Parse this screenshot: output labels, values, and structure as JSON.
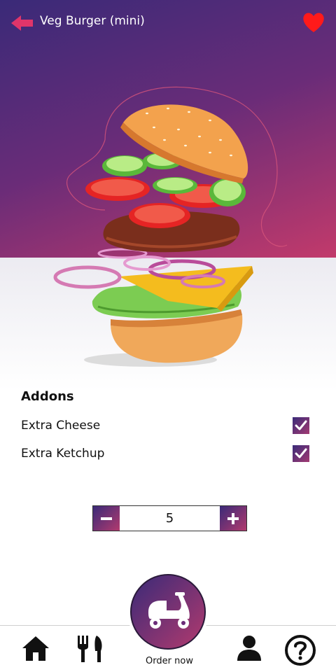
{
  "header": {
    "title": "Veg Burger (mini)",
    "back_icon": "arrow-left-icon",
    "favorite_icon": "heart-icon",
    "favorite_color": "#ff1a1a",
    "back_color": "#e0356a"
  },
  "theme": {
    "gradient_start": "#3a2a78",
    "gradient_end": "#c23a6b"
  },
  "addons": {
    "title": "Addons",
    "items": [
      {
        "label": "Extra Cheese",
        "checked": true
      },
      {
        "label": "Extra Ketchup",
        "checked": true
      }
    ]
  },
  "quantity": {
    "value": "5",
    "decrement_icon": "minus-icon",
    "increment_icon": "plus-icon"
  },
  "nav": {
    "home_icon": "home-icon",
    "menu_icon": "fork-knife-icon",
    "order_icon": "scooter-icon",
    "order_label": "Order now",
    "profile_icon": "user-icon",
    "help_icon": "help-icon"
  }
}
